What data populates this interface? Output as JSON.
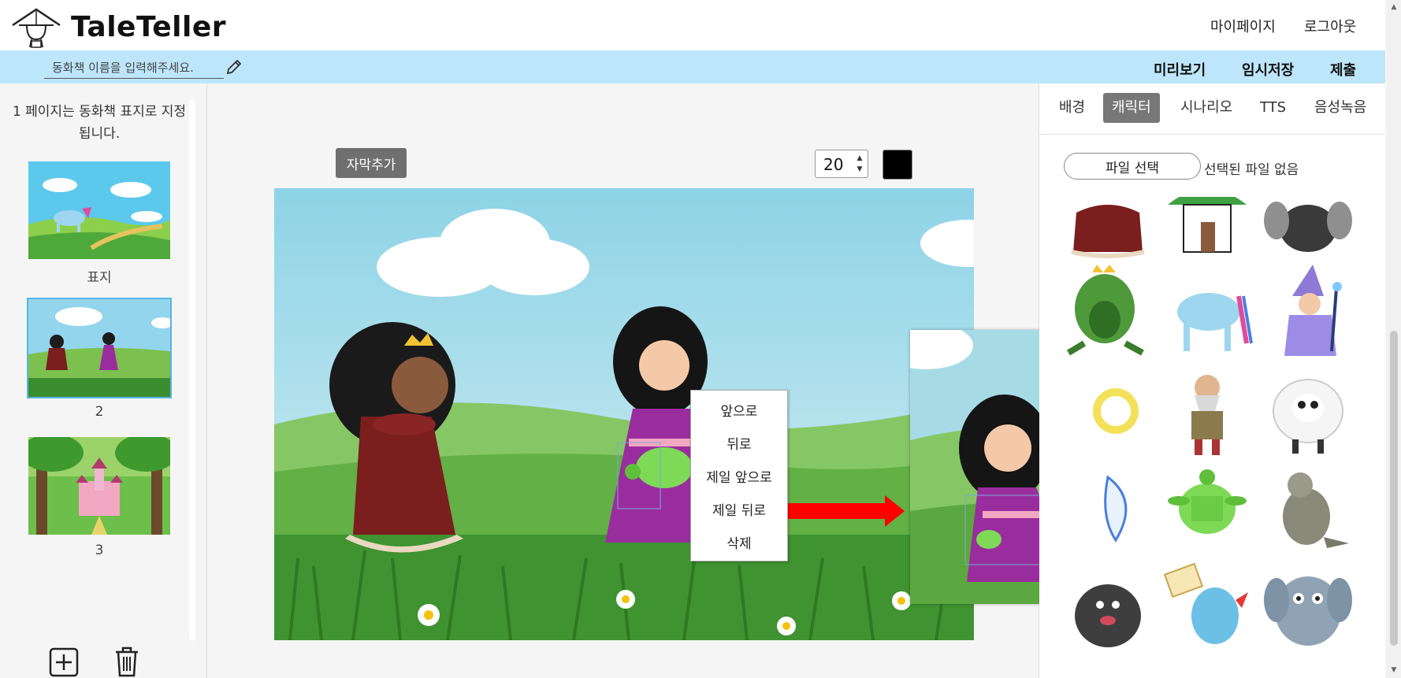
{
  "header": {
    "logo_text": "TaleTeller",
    "mypage": "마이페이지",
    "logout": "로그아웃"
  },
  "toolbar": {
    "title_placeholder": "동화책 이름을 입력해주세요.",
    "preview": "미리보기",
    "temp_save": "임시저장",
    "submit": "제출"
  },
  "left": {
    "note": "1 페이지는 동화책 표지로 지정됩니다.",
    "pages": [
      {
        "label": "표지"
      },
      {
        "label": "2"
      },
      {
        "label": "3"
      }
    ]
  },
  "editor": {
    "add_caption": "자막추가",
    "font_size": "20",
    "text_color": "#000000"
  },
  "context_menu": {
    "items": [
      "앞으로",
      "뒤로",
      "제일 앞으로",
      "제일 뒤로",
      "삭제"
    ]
  },
  "right": {
    "tabs": [
      "배경",
      "캐릭터",
      "시나리오",
      "TTS",
      "음성녹음"
    ],
    "active_tab": "캐릭터",
    "file_button": "파일 선택",
    "file_status": "선택된 파일 없음"
  },
  "colors": {
    "accent_bar": "#bde6fb",
    "arrow": "#ff0000"
  }
}
